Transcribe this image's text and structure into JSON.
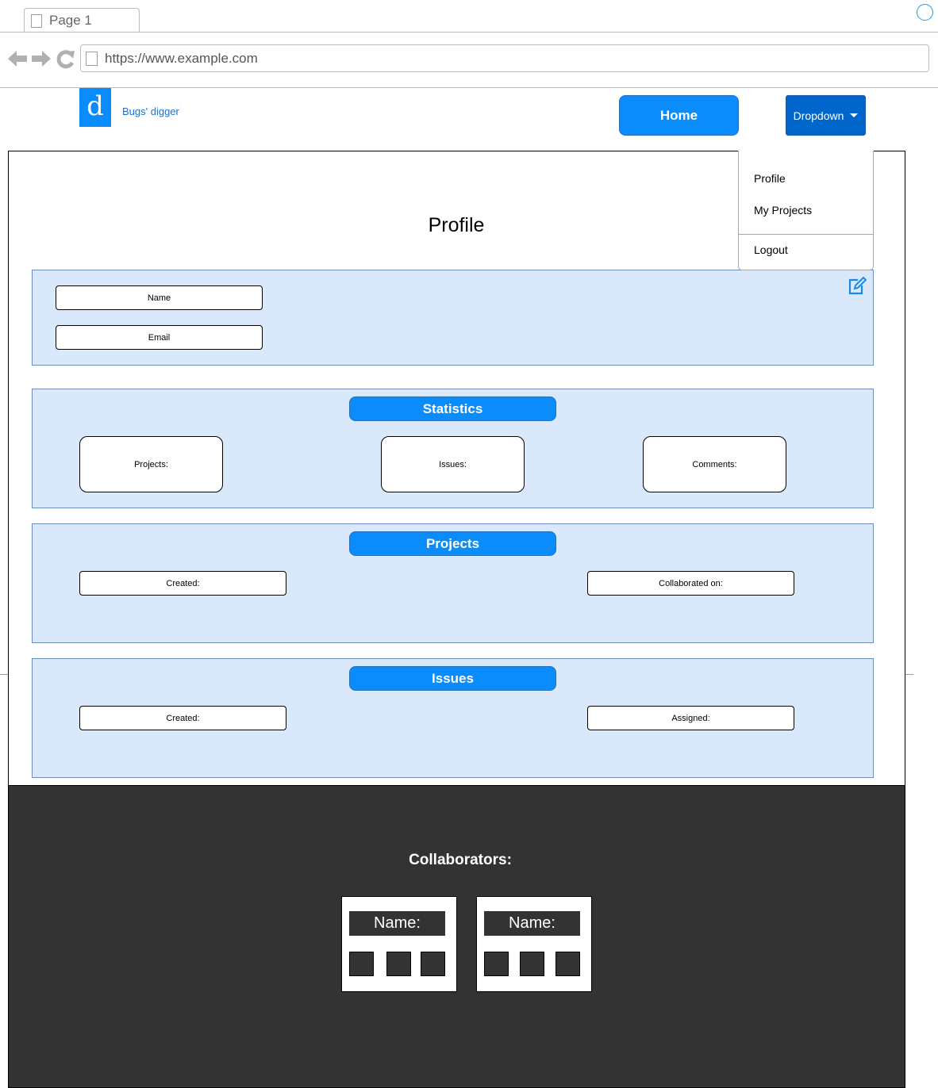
{
  "browser": {
    "tab_label": "Page 1",
    "url": "https://www.example.com"
  },
  "header": {
    "logo_letter": "d",
    "brand": "Bugs' digger",
    "home_label": "Home",
    "dropdown_label": "Dropdown"
  },
  "menu": {
    "items": [
      "Profile",
      "My Projects"
    ],
    "logout": "Logout"
  },
  "page": {
    "title": "Profile"
  },
  "user_panel": {
    "name_field": "Name",
    "email_field": "Email"
  },
  "statistics": {
    "heading": "Statistics",
    "projects": "Projects:",
    "issues": "Issues:",
    "comments": "Comments:"
  },
  "projects": {
    "heading": "Projects",
    "created": "Created:",
    "collaborated": "Collaborated on:"
  },
  "issues": {
    "heading": "Issues",
    "created": "Created:",
    "assigned": "Assigned:"
  },
  "collaborators": {
    "heading": "Collaborators:",
    "cards": [
      {
        "name": "Name:"
      },
      {
        "name": "Name:"
      }
    ]
  },
  "colors": {
    "accent": "#0a8cfc",
    "dropdown": "#0066cc",
    "panel": "#dae8fc",
    "footer": "#333333"
  }
}
